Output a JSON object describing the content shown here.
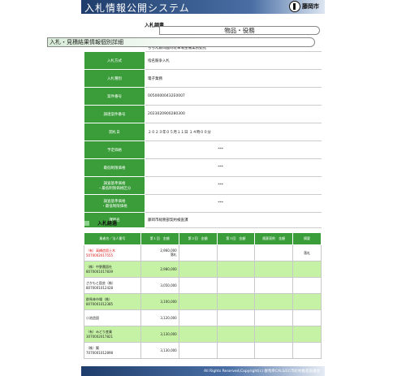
{
  "header": {
    "title": "入札情報公開システム",
    "city": "藤岡市"
  },
  "section_bid": "入札調書",
  "category_pill": "物品・役務",
  "page_pill": "入札・見積結果情報個別詳細",
  "details": [
    {
      "label": "件名",
      "value": "ららん藤岡臨時駐車場整備業務委託"
    },
    {
      "label": "入札方式",
      "value": "指名競争入札"
    },
    {
      "label": "入札種別",
      "value": "電子業務"
    },
    {
      "label": "案件番号",
      "value": "00500000432E0007"
    },
    {
      "label": "調達案件番号",
      "value": "2023020900280300"
    },
    {
      "label": "開札日",
      "value": "２０２３年０５月１１日 １４時００分"
    },
    {
      "label": "予定価格",
      "value": "***"
    },
    {
      "label": "最低制限価格",
      "value": "***"
    },
    {
      "label": "調査基準価格\n・最低制限価格区分",
      "value": "***"
    },
    {
      "label": "調査基準価格\n・最低制限価格",
      "value": "***"
    },
    {
      "label": "課所名",
      "value": "藤岡市総務部契約検査課"
    }
  ],
  "section_results": "入札経過",
  "results_headers": [
    "業者名／法人番号",
    "第１回　金額",
    "第２回　金額",
    "第３回　金額",
    "随意契約　金額",
    "摘要"
  ],
  "results": [
    {
      "name": "（有）高橋造園土木",
      "id": "5070002017555",
      "amt": "2,960,000",
      "note": "落札",
      "red": true,
      "hl": false
    },
    {
      "name": "（株）中野農園社",
      "id": "8070001017839",
      "amt": "2,980,000",
      "note": "",
      "red": false,
      "hl": true
    },
    {
      "name": "さかもと園芸（株）",
      "id": "8070001012428",
      "amt": "3,050,000",
      "note": "",
      "red": false,
      "hl": false
    },
    {
      "name": "群馬林市場（株）",
      "id": "8070001012385",
      "amt": "3,100,000",
      "note": "",
      "red": false,
      "hl": true
    },
    {
      "name": "小池造園",
      "id": "",
      "amt": "3,120,000",
      "note": "",
      "red": false,
      "hl": false
    },
    {
      "name": "（有）みどり産業",
      "id": "3070002017821",
      "amt": "3,130,000",
      "note": "",
      "red": false,
      "hl": true
    },
    {
      "name": "（株）築",
      "id": "7070001012898",
      "amt": "3,130,000",
      "note": "",
      "red": false,
      "hl": false
    }
  ],
  "footer": "All Rights Reserved,Copyright(c) 群馬県CALS/EC市町村推進協議会"
}
